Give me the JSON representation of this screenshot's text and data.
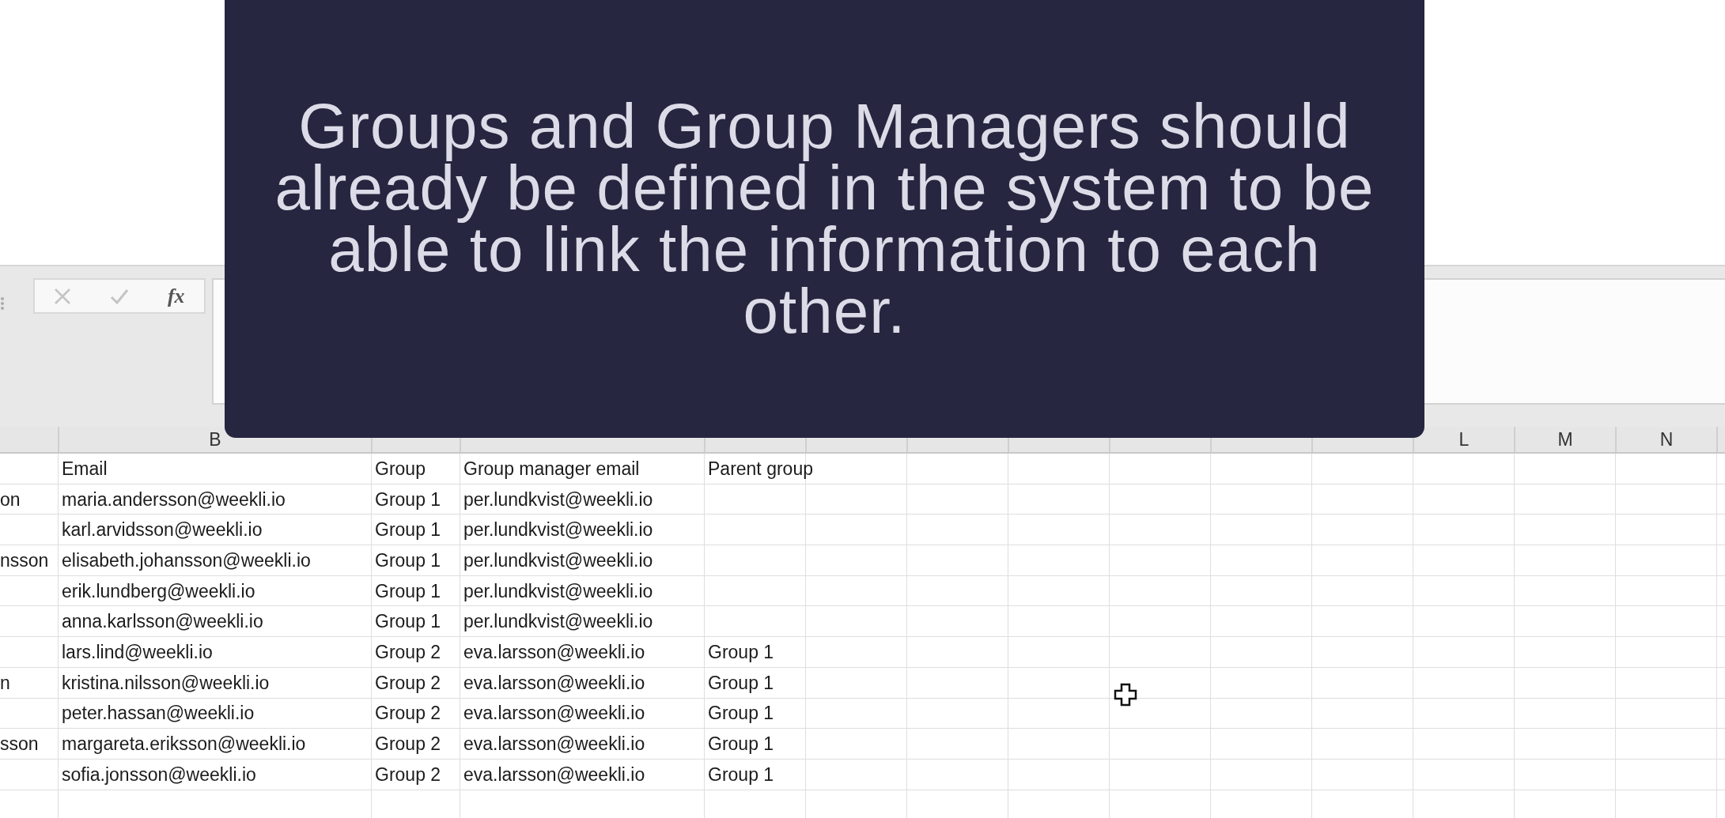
{
  "caption": "Groups and Group Managers should already be defined in the system to be able to link the information to each other.",
  "formula_bar": {
    "function_label": "fx"
  },
  "column_headers": {
    "b": "B",
    "l": "L",
    "m": "M",
    "n": "N"
  },
  "header_row": {
    "email": "Email",
    "group": "Group",
    "manager_email": "Group manager email",
    "parent_group": "Parent group"
  },
  "rows": [
    {
      "column_a": "on",
      "email": "maria.andersson@weekli.io",
      "group": "Group 1",
      "manager_email": "per.lundkvist@weekli.io"
    },
    {
      "email": "karl.arvidsson@weekli.io",
      "group": "Group 1",
      "manager_email": "per.lundkvist@weekli.io"
    },
    {
      "column_a": "nsson",
      "email": "elisabeth.johansson@weekli.io",
      "group": "Group 1",
      "manager_email": "per.lundkvist@weekli.io"
    },
    {
      "email": "erik.lundberg@weekli.io",
      "group": "Group 1",
      "manager_email": "per.lundkvist@weekli.io"
    },
    {
      "email": "anna.karlsson@weekli.io",
      "group": "Group 1",
      "manager_email": "per.lundkvist@weekli.io"
    },
    {
      "email": "lars.lind@weekli.io",
      "group": "Group 2",
      "manager_email": "eva.larsson@weekli.io",
      "parent_group": "Group 1"
    },
    {
      "column_a": "n",
      "email": "kristina.nilsson@weekli.io",
      "group": "Group 2",
      "manager_email": "eva.larsson@weekli.io",
      "parent_group": "Group 1"
    },
    {
      "email": "peter.hassan@weekli.io",
      "group": "Group 2",
      "manager_email": "eva.larsson@weekli.io",
      "parent_group": "Group 1"
    },
    {
      "column_a": "sson",
      "email": "margareta.eriksson@weekli.io",
      "group": "Group 2",
      "manager_email": "eva.larsson@weekli.io",
      "parent_group": "Group 1"
    },
    {
      "email": "sofia.jonsson@weekli.io",
      "group": "Group 2",
      "manager_email": "eva.larsson@weekli.io",
      "parent_group": "Group 1"
    }
  ]
}
